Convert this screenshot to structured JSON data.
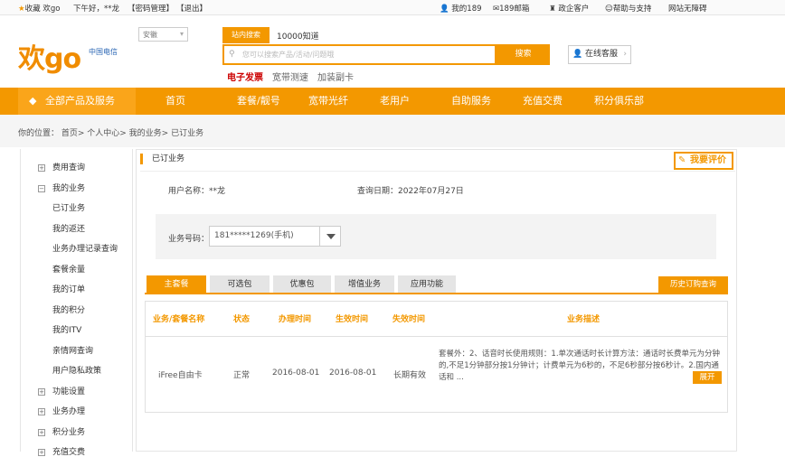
{
  "topbar": {
    "fav": "收藏 欢go",
    "greeting": "下午好，**龙",
    "pwd": "【密码管理】",
    "logout": "【退出】",
    "my189": "我的189",
    "mail": "189邮箱",
    "gov": "政企客户",
    "help": "帮助与支持",
    "barrier_free": "网站无障碍"
  },
  "header": {
    "logo": "欢go",
    "carrier": "中国电信",
    "region": "安徽",
    "search_tab_on": "站内搜索",
    "search_tab_off": "10000知道",
    "search_placeholder": "您可以搜索产品/活动/问题哦",
    "search_button": "搜索",
    "hot_links": [
      "电子发票",
      "宽带测速",
      "加装副卡"
    ],
    "customer_service": "在线客服"
  },
  "nav": {
    "all": "全部产品及服务",
    "items": [
      "首页",
      "套餐/靓号",
      "宽带光纤",
      "老用户",
      "自助服务",
      "充值交费",
      "积分俱乐部"
    ]
  },
  "breadcrumb": "你的位置：  首页> 个人中心> 我的业务> 已订业务",
  "sidebar": {
    "items": [
      {
        "label": "费用查询",
        "mark": "+"
      },
      {
        "label": "我的业务",
        "mark": "−"
      },
      {
        "label": "已订业务",
        "mark": ""
      },
      {
        "label": "我的返还",
        "mark": ""
      },
      {
        "label": "业务办理记录查询",
        "mark": ""
      },
      {
        "label": "套餐余量",
        "mark": ""
      },
      {
        "label": "我的订单",
        "mark": ""
      },
      {
        "label": "我的积分",
        "mark": ""
      },
      {
        "label": "我的ITV",
        "mark": ""
      },
      {
        "label": "亲情网查询",
        "mark": ""
      },
      {
        "label": "用户隐私政策",
        "mark": ""
      },
      {
        "label": "功能设置",
        "mark": "+"
      },
      {
        "label": "业务办理",
        "mark": "+"
      },
      {
        "label": "积分业务",
        "mark": "+"
      },
      {
        "label": "充值交费",
        "mark": "+"
      }
    ]
  },
  "main": {
    "title": "已订业务",
    "rate": "我要评价",
    "user_label": "用户名称：**龙",
    "date_label": "查询日期：2022年07月27日",
    "number_label": "业务号码：",
    "number_value": "181*****1269(手机)",
    "tabs": [
      "主套餐",
      "可选包",
      "优惠包",
      "增值业务",
      "应用功能"
    ],
    "history": "历史订购查询",
    "columns": [
      "业务/套餐名称",
      "状态",
      "办理时间",
      "生效时间",
      "失效时间",
      "业务描述"
    ],
    "row": {
      "name": "iFree自由卡",
      "status": "正常",
      "handle": "2016-08-01",
      "effect": "2016-08-01",
      "expire": "长期有效",
      "desc": "套餐外：2、话音时长使用规则：1.单次通话时长计算方法：通话时长费单元为分钟的,不足1分钟部分按1分钟计；计费单元为6秒的，不足6秒部分按6秒计。2.国内通话和 ...",
      "expand": "展开"
    }
  }
}
